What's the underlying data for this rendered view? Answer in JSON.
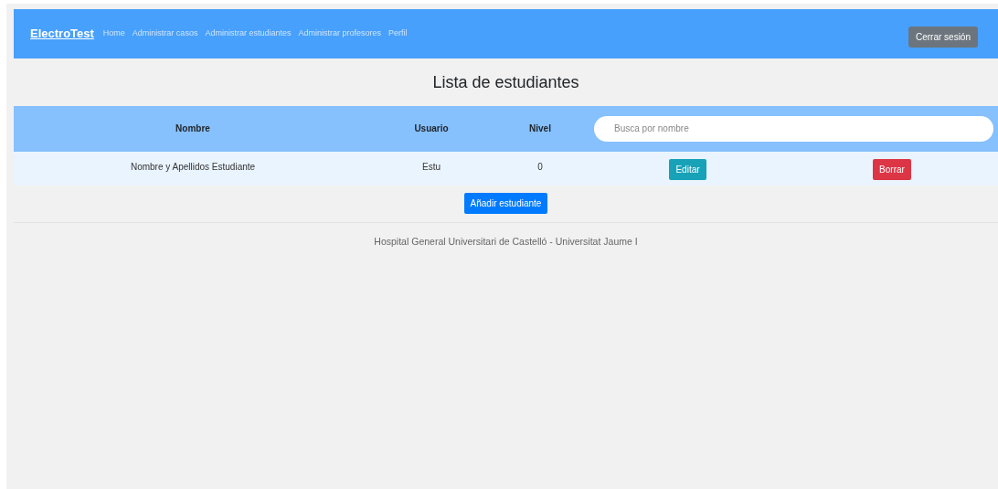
{
  "navbar": {
    "brand": "ElectroTest",
    "links": [
      {
        "label": "Home"
      },
      {
        "label": "Administrar casos"
      },
      {
        "label": "Administrar estudiantes"
      },
      {
        "label": "Administrar profesores"
      },
      {
        "label": "Perfil"
      }
    ],
    "logout": "Cerrar sesión"
  },
  "title": "Lista de estudiantes",
  "table": {
    "columns": [
      "Nombre",
      "Usuario",
      "Nivel"
    ],
    "search": {
      "placeholder": "Busca por nombre"
    },
    "rows": [
      {
        "name": "Nombre y Apellidos Estudiante",
        "user": "Estu",
        "level": "0",
        "edit": "Editar",
        "delete": "Borrar"
      }
    ]
  },
  "add_button": "Añadir estudiante",
  "footer": "Hospital General Universitari de Castelló - Universitat Jaume I"
}
